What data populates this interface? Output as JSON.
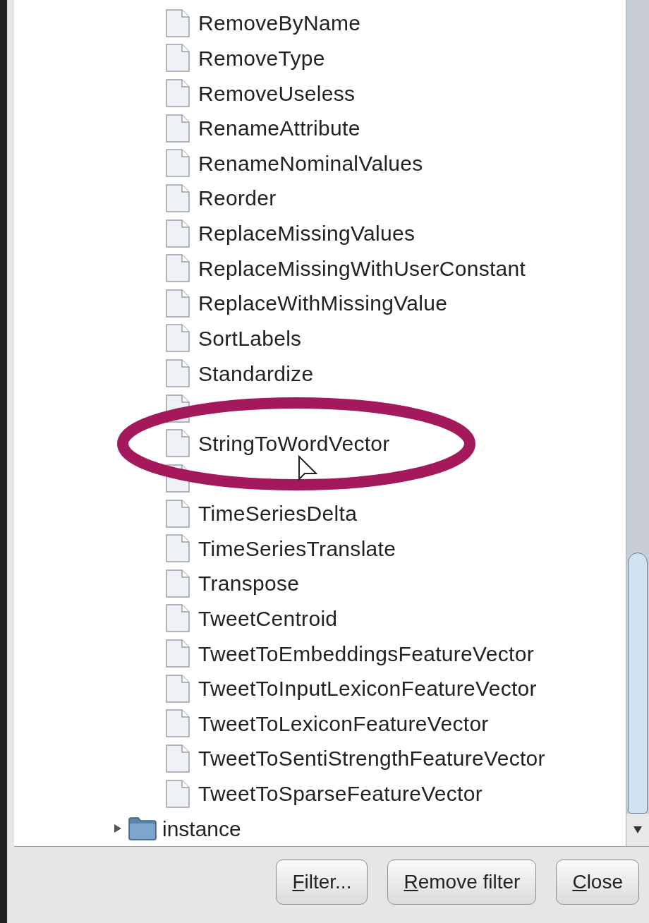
{
  "tree": {
    "items": [
      {
        "kind": "file",
        "label": "RemoveByName"
      },
      {
        "kind": "file",
        "label": "RemoveType"
      },
      {
        "kind": "file",
        "label": "RemoveUseless"
      },
      {
        "kind": "file",
        "label": "RenameAttribute"
      },
      {
        "kind": "file",
        "label": "RenameNominalValues"
      },
      {
        "kind": "file",
        "label": "Reorder"
      },
      {
        "kind": "file",
        "label": "ReplaceMissingValues"
      },
      {
        "kind": "file",
        "label": "ReplaceMissingWithUserConstant"
      },
      {
        "kind": "file",
        "label": "ReplaceWithMissingValue"
      },
      {
        "kind": "file",
        "label": "SortLabels"
      },
      {
        "kind": "file",
        "label": "Standardize"
      },
      {
        "kind": "file"
      },
      {
        "kind": "file",
        "label": "StringToWordVector"
      },
      {
        "kind": "file"
      },
      {
        "kind": "file",
        "label": "TimeSeriesDelta"
      },
      {
        "kind": "file",
        "label": "TimeSeriesTranslate"
      },
      {
        "kind": "file",
        "label": "Transpose"
      },
      {
        "kind": "file",
        "label": "TweetCentroid"
      },
      {
        "kind": "file",
        "label": "TweetToEmbeddingsFeatureVector"
      },
      {
        "kind": "file",
        "label": "TweetToInputLexiconFeatureVector"
      },
      {
        "kind": "file",
        "label": "TweetToLexiconFeatureVector"
      },
      {
        "kind": "file",
        "label": "TweetToSentiStrengthFeatureVector"
      },
      {
        "kind": "file",
        "label": "TweetToSparseFeatureVector"
      },
      {
        "kind": "folder",
        "label": "instance",
        "expanded": false
      }
    ]
  },
  "buttons": [
    {
      "label": "Filter..."
    },
    {
      "label": "Remove filter"
    },
    {
      "label": "Close"
    }
  ]
}
